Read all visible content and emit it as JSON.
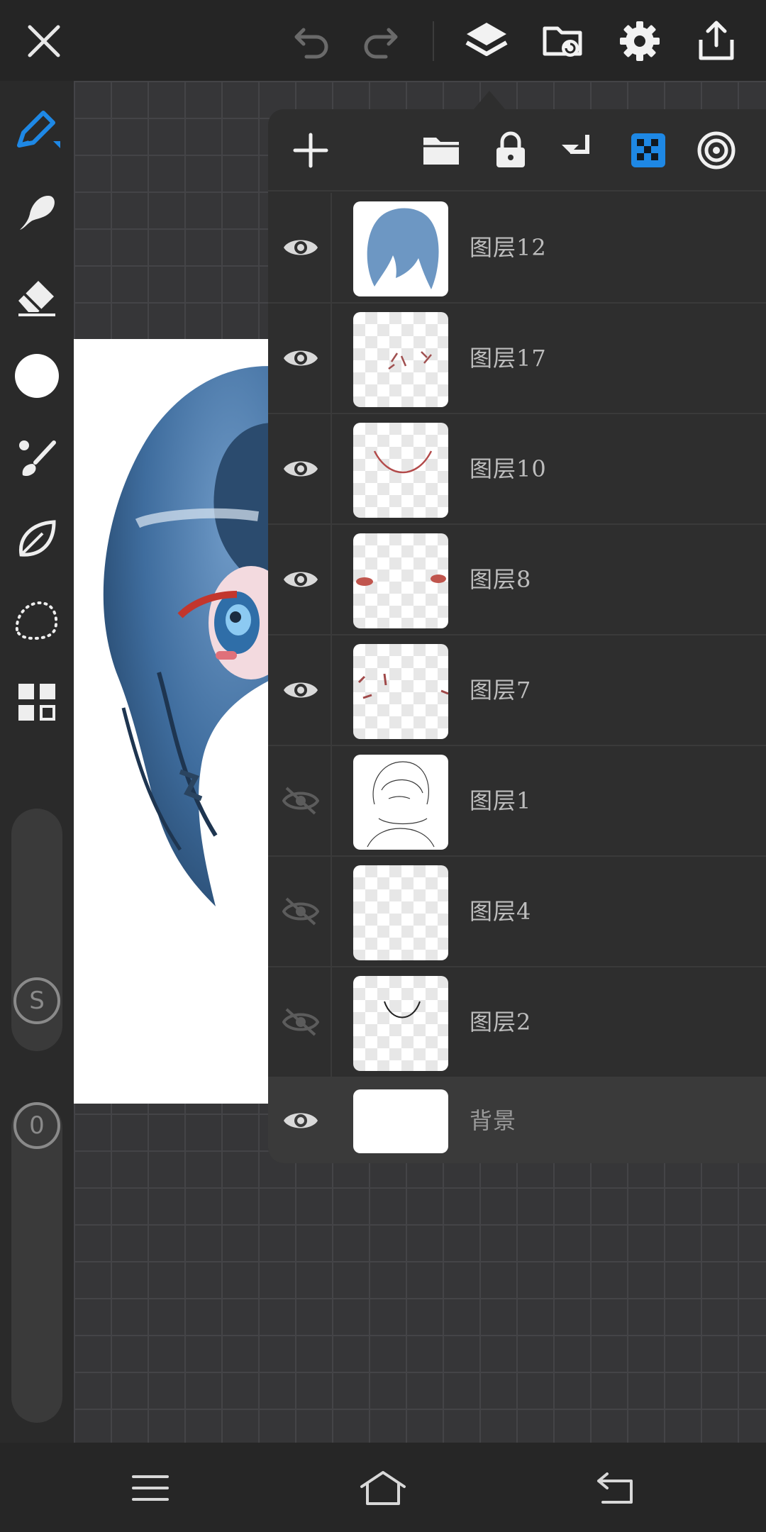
{
  "accent_color": "#1e88e5",
  "topbar": {
    "icons": [
      "close-icon",
      "undo-icon",
      "redo-icon",
      "layers-icon",
      "import-icon",
      "gear-icon",
      "share-icon"
    ]
  },
  "leftbar": {
    "tools": [
      "pen-icon",
      "smudge-icon",
      "eraser-icon",
      "color-swatch",
      "brush-picker-icon",
      "leaf-icon",
      "lasso-icon",
      "grid-icon"
    ],
    "size_slider_label": "S",
    "opacity_slider_label": "0"
  },
  "layer_panel": {
    "toolbar_icons": [
      "add-icon",
      "folder-icon",
      "lock-icon",
      "merge-down-icon",
      "transparency-lock-icon",
      "target-icon"
    ],
    "layers": [
      {
        "name": "图层12",
        "visible": true
      },
      {
        "name": "图层17",
        "visible": true
      },
      {
        "name": "图层10",
        "visible": true
      },
      {
        "name": "图层8",
        "visible": true
      },
      {
        "name": "图层7",
        "visible": true
      },
      {
        "name": "图层1",
        "visible": false
      },
      {
        "name": "图层4",
        "visible": false
      },
      {
        "name": "图层2",
        "visible": false
      },
      {
        "name": "背景",
        "visible": true
      }
    ]
  },
  "bottom_nav": {
    "icons": [
      "menu-icon",
      "home-icon",
      "back-icon"
    ]
  }
}
